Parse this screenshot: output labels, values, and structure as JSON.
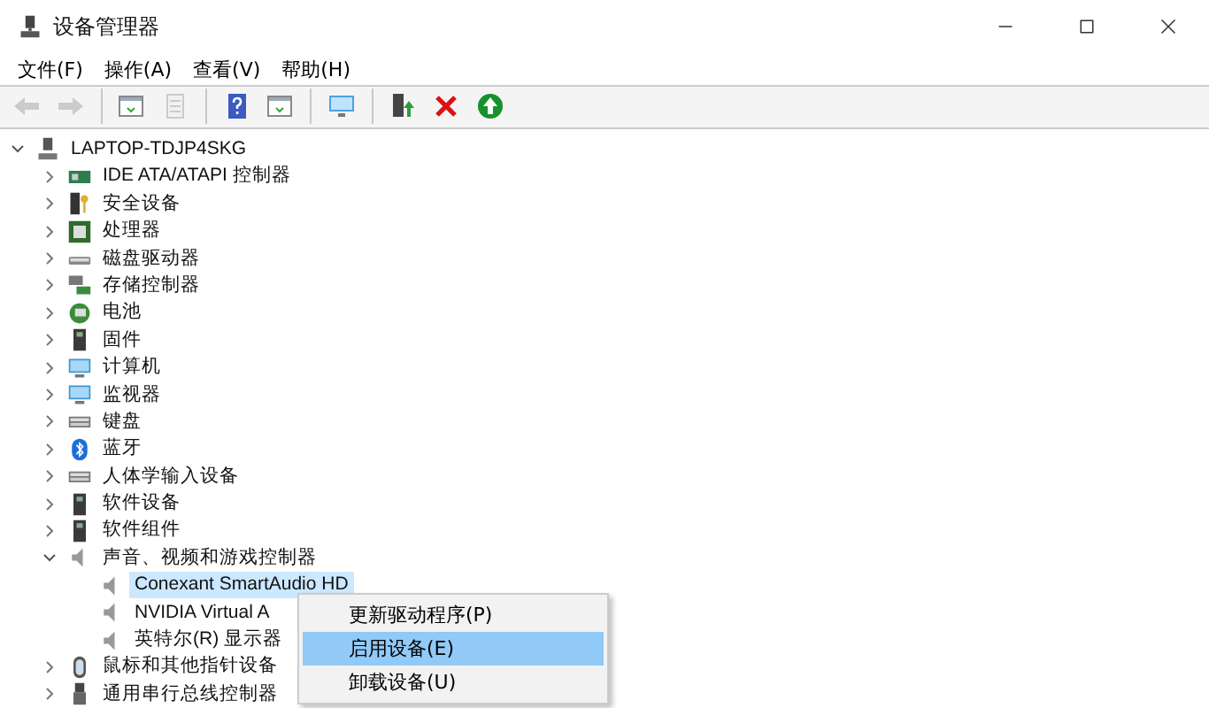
{
  "window": {
    "title": "设备管理器"
  },
  "menu": [
    "文件(F)",
    "操作(A)",
    "查看(V)",
    "帮助(H)"
  ],
  "toolbar": [
    {
      "kind": "back",
      "disabled": true
    },
    {
      "kind": "forward",
      "disabled": true
    },
    {
      "kind": "sep"
    },
    {
      "kind": "panel",
      "disabled": false
    },
    {
      "kind": "properties",
      "disabled": true
    },
    {
      "kind": "sep"
    },
    {
      "kind": "help",
      "disabled": false
    },
    {
      "kind": "panel",
      "disabled": false
    },
    {
      "kind": "sep"
    },
    {
      "kind": "monitor",
      "disabled": false
    },
    {
      "kind": "sep"
    },
    {
      "kind": "update",
      "disabled": false
    },
    {
      "kind": "remove",
      "disabled": false
    },
    {
      "kind": "enable",
      "disabled": false
    }
  ],
  "tree": [
    {
      "label": "LAPTOP-TDJP4SKG",
      "kind": "computer",
      "expanded": true,
      "selected": false,
      "children": [
        {
          "label": "IDE ATA/ATAPI 控制器",
          "kind": "card",
          "expanded": false,
          "selected": false
        },
        {
          "label": "安全设备",
          "kind": "key",
          "expanded": false,
          "selected": false
        },
        {
          "label": "处理器",
          "kind": "chip",
          "expanded": false,
          "selected": false
        },
        {
          "label": "磁盘驱动器",
          "kind": "disk",
          "expanded": false,
          "selected": false
        },
        {
          "label": "存储控制器",
          "kind": "storage",
          "expanded": false,
          "selected": false
        },
        {
          "label": "电池",
          "kind": "battery",
          "expanded": false,
          "selected": false
        },
        {
          "label": "固件",
          "kind": "firmware",
          "expanded": false,
          "selected": false
        },
        {
          "label": "计算机",
          "kind": "monitor",
          "expanded": false,
          "selected": false
        },
        {
          "label": "监视器",
          "kind": "monitor",
          "expanded": false,
          "selected": false
        },
        {
          "label": "键盘",
          "kind": "keyboard",
          "expanded": false,
          "selected": false
        },
        {
          "label": "蓝牙",
          "kind": "bluetooth",
          "expanded": false,
          "selected": false
        },
        {
          "label": "人体学输入设备",
          "kind": "keyboard",
          "expanded": false,
          "selected": false
        },
        {
          "label": "软件设备",
          "kind": "firmware",
          "expanded": false,
          "selected": false
        },
        {
          "label": "软件组件",
          "kind": "firmware",
          "expanded": false,
          "selected": false
        },
        {
          "label": "声音、视频和游戏控制器",
          "kind": "speaker",
          "expanded": true,
          "selected": false,
          "children": [
            {
              "label": "Conexant SmartAudio HD",
              "kind": "speaker",
              "selected": true
            },
            {
              "label": "NVIDIA Virtual A",
              "kind": "speaker",
              "selected": false
            },
            {
              "label": "英特尔(R) 显示器",
              "kind": "speaker",
              "selected": false
            }
          ]
        },
        {
          "label": "鼠标和其他指针设备",
          "kind": "mouse",
          "expanded": false,
          "selected": false
        },
        {
          "label": "通用串行总线控制器",
          "kind": "usb",
          "expanded": false,
          "selected": false
        }
      ]
    }
  ],
  "context_menu": [
    {
      "label": "更新驱动程序(P)",
      "selected": false
    },
    {
      "label": "启用设备(E)",
      "selected": true
    },
    {
      "label": "卸载设备(U)",
      "selected": false
    }
  ]
}
